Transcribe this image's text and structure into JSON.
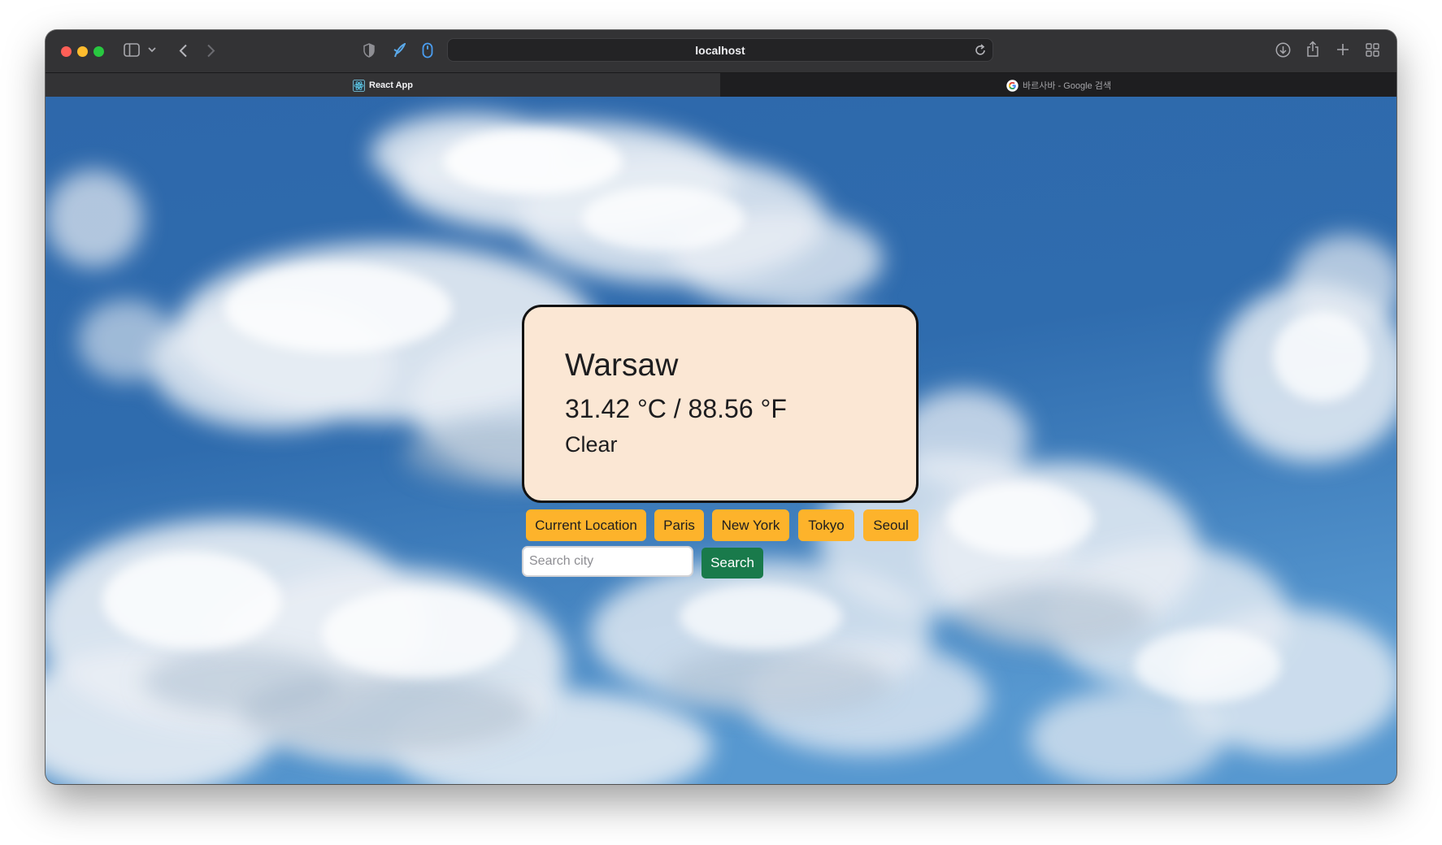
{
  "browser": {
    "address": "localhost",
    "tabs": [
      {
        "label": "React App",
        "active": true,
        "icon": "react-icon"
      },
      {
        "label": "바르사바 - Google 검색",
        "active": false,
        "icon": "google-icon"
      }
    ]
  },
  "weather": {
    "city": "Warsaw",
    "temperature": "31.42 °C / 88.56 °F",
    "condition": "Clear"
  },
  "city_buttons": [
    {
      "label": "Current Location"
    },
    {
      "label": "Paris"
    },
    {
      "label": "New York"
    },
    {
      "label": "Tokyo"
    },
    {
      "label": "Seoul"
    }
  ],
  "search": {
    "placeholder": "Search city",
    "value": "",
    "button_label": "Search"
  },
  "colors": {
    "card_background": "#fbe7d4",
    "city_button": "#fdb32b",
    "search_button": "#197a4b",
    "sky": "#2f6cad"
  }
}
